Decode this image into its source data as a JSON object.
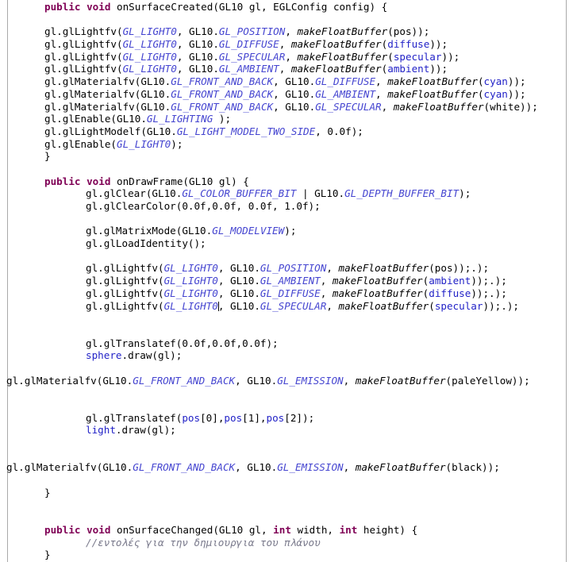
{
  "editor": {
    "kind": "java-source-editor",
    "language": "Java",
    "colors": {
      "background": "#ffffff",
      "foreground": "#000000",
      "keyword": "#7f0055",
      "static_constant": "#4545d0",
      "field": "#2222c7",
      "method": "#000000",
      "comment": "#7a7a8c",
      "rule": "#a9a9a9"
    },
    "caret": {
      "line_index": 24,
      "after_token": "GL_LIGHT0"
    }
  },
  "lines": [
    {
      "indent": 48,
      "tokens": [
        {
          "t": "public",
          "c": "kw"
        },
        {
          "t": " ",
          "c": "plain"
        },
        {
          "t": "void",
          "c": "kw"
        },
        {
          "t": " onSurfaceCreated(GL10 gl, EGLConfig config) {",
          "c": "plain"
        }
      ]
    },
    {
      "indent": 0,
      "tokens": []
    },
    {
      "indent": 48,
      "tokens": [
        {
          "t": "gl.glLightfv(",
          "c": "plain"
        },
        {
          "t": "GL_LIGHT0",
          "c": "const"
        },
        {
          "t": ", GL10.",
          "c": "plain"
        },
        {
          "t": "GL_POSITION",
          "c": "const"
        },
        {
          "t": ", ",
          "c": "plain"
        },
        {
          "t": "makeFloatBuffer",
          "c": "method"
        },
        {
          "t": "(pos));",
          "c": "plain"
        }
      ]
    },
    {
      "indent": 48,
      "tokens": [
        {
          "t": "gl.glLightfv(",
          "c": "plain"
        },
        {
          "t": "GL_LIGHT0",
          "c": "const"
        },
        {
          "t": ", GL10.",
          "c": "plain"
        },
        {
          "t": "GL_DIFFUSE",
          "c": "const"
        },
        {
          "t": ", ",
          "c": "plain"
        },
        {
          "t": "makeFloatBuffer",
          "c": "method"
        },
        {
          "t": "(",
          "c": "plain"
        },
        {
          "t": "diffuse",
          "c": "field"
        },
        {
          "t": "));",
          "c": "plain"
        }
      ]
    },
    {
      "indent": 48,
      "tokens": [
        {
          "t": "gl.glLightfv(",
          "c": "plain"
        },
        {
          "t": "GL_LIGHT0",
          "c": "const"
        },
        {
          "t": ", GL10.",
          "c": "plain"
        },
        {
          "t": "GL_SPECULAR",
          "c": "const"
        },
        {
          "t": ", ",
          "c": "plain"
        },
        {
          "t": "makeFloatBuffer",
          "c": "method"
        },
        {
          "t": "(",
          "c": "plain"
        },
        {
          "t": "specular",
          "c": "field"
        },
        {
          "t": "));",
          "c": "plain"
        }
      ]
    },
    {
      "indent": 48,
      "tokens": [
        {
          "t": "gl.glLightfv(",
          "c": "plain"
        },
        {
          "t": "GL_LIGHT0",
          "c": "const"
        },
        {
          "t": ", GL10.",
          "c": "plain"
        },
        {
          "t": "GL_AMBIENT",
          "c": "const"
        },
        {
          "t": ", ",
          "c": "plain"
        },
        {
          "t": "makeFloatBuffer",
          "c": "method"
        },
        {
          "t": "(",
          "c": "plain"
        },
        {
          "t": "ambient",
          "c": "field"
        },
        {
          "t": "));",
          "c": "plain"
        }
      ]
    },
    {
      "indent": 48,
      "tokens": [
        {
          "t": "gl.glMaterialfv(GL10.",
          "c": "plain"
        },
        {
          "t": "GL_FRONT_AND_BACK",
          "c": "const"
        },
        {
          "t": ", GL10.",
          "c": "plain"
        },
        {
          "t": "GL_DIFFUSE",
          "c": "const"
        },
        {
          "t": ", ",
          "c": "plain"
        },
        {
          "t": "makeFloatBuffer",
          "c": "method"
        },
        {
          "t": "(",
          "c": "plain"
        },
        {
          "t": "cyan",
          "c": "field"
        },
        {
          "t": "));",
          "c": "plain"
        }
      ]
    },
    {
      "indent": 48,
      "tokens": [
        {
          "t": "gl.glMaterialfv(GL10.",
          "c": "plain"
        },
        {
          "t": "GL_FRONT_AND_BACK",
          "c": "const"
        },
        {
          "t": ", GL10.",
          "c": "plain"
        },
        {
          "t": "GL_AMBIENT",
          "c": "const"
        },
        {
          "t": ", ",
          "c": "plain"
        },
        {
          "t": "makeFloatBuffer",
          "c": "method"
        },
        {
          "t": "(",
          "c": "plain"
        },
        {
          "t": "cyan",
          "c": "field"
        },
        {
          "t": "));",
          "c": "plain"
        }
      ]
    },
    {
      "indent": 48,
      "tokens": [
        {
          "t": "gl.glMaterialfv(GL10.",
          "c": "plain"
        },
        {
          "t": "GL_FRONT_AND_BACK",
          "c": "const"
        },
        {
          "t": ", GL10.",
          "c": "plain"
        },
        {
          "t": "GL_SPECULAR",
          "c": "const"
        },
        {
          "t": ", ",
          "c": "plain"
        },
        {
          "t": "makeFloatBuffer",
          "c": "method"
        },
        {
          "t": "(white));",
          "c": "plain"
        }
      ]
    },
    {
      "indent": 48,
      "tokens": [
        {
          "t": "gl.glEnable(GL10.",
          "c": "plain"
        },
        {
          "t": "GL_LIGHTING",
          "c": "const"
        },
        {
          "t": " );",
          "c": "plain"
        }
      ]
    },
    {
      "indent": 48,
      "tokens": [
        {
          "t": "gl.glLightModelf(GL10.",
          "c": "plain"
        },
        {
          "t": "GL_LIGHT_MODEL_TWO_SIDE",
          "c": "const"
        },
        {
          "t": ", 0.0f);",
          "c": "plain"
        }
      ]
    },
    {
      "indent": 48,
      "tokens": [
        {
          "t": "gl.glEnable(",
          "c": "plain"
        },
        {
          "t": "GL_LIGHT0",
          "c": "const"
        },
        {
          "t": ");",
          "c": "plain"
        }
      ]
    },
    {
      "indent": 48,
      "tokens": [
        {
          "t": "}",
          "c": "plain"
        }
      ]
    },
    {
      "indent": 0,
      "tokens": []
    },
    {
      "indent": 48,
      "tokens": [
        {
          "t": "public",
          "c": "kw"
        },
        {
          "t": " ",
          "c": "plain"
        },
        {
          "t": "void",
          "c": "kw"
        },
        {
          "t": " onDrawFrame(GL10 gl) {",
          "c": "plain"
        }
      ]
    },
    {
      "indent": 100,
      "tokens": [
        {
          "t": "gl.glClear(GL10.",
          "c": "plain"
        },
        {
          "t": "GL_COLOR_BUFFER_BIT",
          "c": "const"
        },
        {
          "t": " | GL10.",
          "c": "plain"
        },
        {
          "t": "GL_DEPTH_BUFFER_BIT",
          "c": "const"
        },
        {
          "t": ");",
          "c": "plain"
        }
      ]
    },
    {
      "indent": 100,
      "tokens": [
        {
          "t": "gl.glClearColor(0.0f,0.0f, 0.0f, 1.0f);",
          "c": "plain"
        }
      ]
    },
    {
      "indent": 0,
      "tokens": []
    },
    {
      "indent": 100,
      "tokens": [
        {
          "t": "gl.glMatrixMode(GL10.",
          "c": "plain"
        },
        {
          "t": "GL_MODELVIEW",
          "c": "const"
        },
        {
          "t": ");",
          "c": "plain"
        }
      ]
    },
    {
      "indent": 100,
      "tokens": [
        {
          "t": "gl.glLoadIdentity();",
          "c": "plain"
        }
      ]
    },
    {
      "indent": 0,
      "tokens": []
    },
    {
      "indent": 100,
      "tokens": [
        {
          "t": "gl.glLightfv(",
          "c": "plain"
        },
        {
          "t": "GL_LIGHT0",
          "c": "const"
        },
        {
          "t": ", GL10.",
          "c": "plain"
        },
        {
          "t": "GL_POSITION",
          "c": "const"
        },
        {
          "t": ", ",
          "c": "plain"
        },
        {
          "t": "makeFloatBuffer",
          "c": "method"
        },
        {
          "t": "(pos));.);",
          "c": "plain"
        }
      ]
    },
    {
      "indent": 100,
      "tokens": [
        {
          "t": "gl.glLightfv(",
          "c": "plain"
        },
        {
          "t": "GL_LIGHT0",
          "c": "const"
        },
        {
          "t": ", GL10.",
          "c": "plain"
        },
        {
          "t": "GL_AMBIENT",
          "c": "const"
        },
        {
          "t": ", ",
          "c": "plain"
        },
        {
          "t": "makeFloatBuffer",
          "c": "method"
        },
        {
          "t": "(",
          "c": "plain"
        },
        {
          "t": "ambient",
          "c": "field"
        },
        {
          "t": "));.);",
          "c": "plain"
        }
      ]
    },
    {
      "indent": 100,
      "tokens": [
        {
          "t": "gl.glLightfv(",
          "c": "plain"
        },
        {
          "t": "GL_LIGHT0",
          "c": "const"
        },
        {
          "t": ", GL10.",
          "c": "plain"
        },
        {
          "t": "GL_DIFFUSE",
          "c": "const"
        },
        {
          "t": ", ",
          "c": "plain"
        },
        {
          "t": "makeFloatBuffer",
          "c": "method"
        },
        {
          "t": "(",
          "c": "plain"
        },
        {
          "t": "diffuse",
          "c": "field"
        },
        {
          "t": "));.);",
          "c": "plain"
        }
      ]
    },
    {
      "indent": 100,
      "tokens": [
        {
          "t": "gl.glLightfv(",
          "c": "plain"
        },
        {
          "t": "GL_LIGHT0",
          "c": "const",
          "caret": true
        },
        {
          "t": ", GL10.",
          "c": "plain"
        },
        {
          "t": "GL_SPECULAR",
          "c": "const"
        },
        {
          "t": ", ",
          "c": "plain"
        },
        {
          "t": "makeFloatBuffer",
          "c": "method"
        },
        {
          "t": "(",
          "c": "plain"
        },
        {
          "t": "specular",
          "c": "field"
        },
        {
          "t": "));.);",
          "c": "plain"
        }
      ]
    },
    {
      "indent": 0,
      "tokens": []
    },
    {
      "indent": 0,
      "tokens": []
    },
    {
      "indent": 100,
      "tokens": [
        {
          "t": "gl.glTranslatef(0.0f,0.0f,0.0f);",
          "c": "plain"
        }
      ]
    },
    {
      "indent": 100,
      "tokens": [
        {
          "t": "sphere",
          "c": "field"
        },
        {
          "t": ".draw(gl);",
          "c": "plain"
        }
      ]
    },
    {
      "indent": 0,
      "tokens": []
    },
    {
      "indent": 0,
      "tokens": [
        {
          "t": "gl.glMaterialfv(GL10.",
          "c": "plain"
        },
        {
          "t": "GL_FRONT_AND_BACK",
          "c": "const"
        },
        {
          "t": ", GL10.",
          "c": "plain"
        },
        {
          "t": "GL_EMISSION",
          "c": "const"
        },
        {
          "t": ", ",
          "c": "plain"
        },
        {
          "t": "makeFloatBuffer",
          "c": "method"
        },
        {
          "t": "(paleYellow));",
          "c": "plain"
        }
      ]
    },
    {
      "indent": 0,
      "tokens": []
    },
    {
      "indent": 0,
      "tokens": []
    },
    {
      "indent": 100,
      "tokens": [
        {
          "t": "gl.glTranslatef(",
          "c": "plain"
        },
        {
          "t": "pos",
          "c": "field"
        },
        {
          "t": "[0],",
          "c": "plain"
        },
        {
          "t": "pos",
          "c": "field"
        },
        {
          "t": "[1],",
          "c": "plain"
        },
        {
          "t": "pos",
          "c": "field"
        },
        {
          "t": "[2]);",
          "c": "plain"
        }
      ]
    },
    {
      "indent": 100,
      "tokens": [
        {
          "t": "light",
          "c": "field"
        },
        {
          "t": ".draw(gl);",
          "c": "plain"
        }
      ]
    },
    {
      "indent": 0,
      "tokens": []
    },
    {
      "indent": 0,
      "tokens": []
    },
    {
      "indent": 0,
      "tokens": [
        {
          "t": "gl.glMaterialfv(GL10.",
          "c": "plain"
        },
        {
          "t": "GL_FRONT_AND_BACK",
          "c": "const"
        },
        {
          "t": ", GL10.",
          "c": "plain"
        },
        {
          "t": "GL_EMISSION",
          "c": "const"
        },
        {
          "t": ", ",
          "c": "plain"
        },
        {
          "t": "makeFloatBuffer",
          "c": "method"
        },
        {
          "t": "(black));",
          "c": "plain"
        }
      ]
    },
    {
      "indent": 0,
      "tokens": []
    },
    {
      "indent": 48,
      "tokens": [
        {
          "t": "}",
          "c": "plain"
        }
      ]
    },
    {
      "indent": 0,
      "tokens": []
    },
    {
      "indent": 0,
      "tokens": []
    },
    {
      "indent": 48,
      "tokens": [
        {
          "t": "public",
          "c": "kw"
        },
        {
          "t": " ",
          "c": "plain"
        },
        {
          "t": "void",
          "c": "kw"
        },
        {
          "t": " onSurfaceChanged(GL10 gl, ",
          "c": "plain"
        },
        {
          "t": "int",
          "c": "kw"
        },
        {
          "t": " width, ",
          "c": "plain"
        },
        {
          "t": "int",
          "c": "kw"
        },
        {
          "t": " height) {",
          "c": "plain"
        }
      ]
    },
    {
      "indent": 100,
      "tokens": [
        {
          "t": "//εντολές για την δημιουργια του πλάνου",
          "c": "cmt"
        }
      ]
    },
    {
      "indent": 48,
      "tokens": [
        {
          "t": "}",
          "c": "plain"
        }
      ]
    }
  ]
}
